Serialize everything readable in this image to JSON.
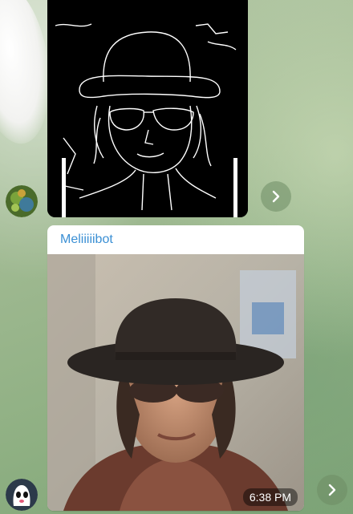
{
  "chat": {
    "messages": [
      {
        "type": "image",
        "image": "edge-detected sketch of person in bowler hat and sunglasses"
      },
      {
        "type": "image",
        "sender_name": "Meliiiiibot",
        "image": "photo of person in bowler hat and sunglasses",
        "time": "6:38 PM"
      }
    ]
  },
  "colors": {
    "sender_name": "#3a8fd4",
    "bubble": "#ffffff",
    "share_button": "#6e8c64"
  },
  "icons": {
    "share": "chevron-right-icon"
  }
}
